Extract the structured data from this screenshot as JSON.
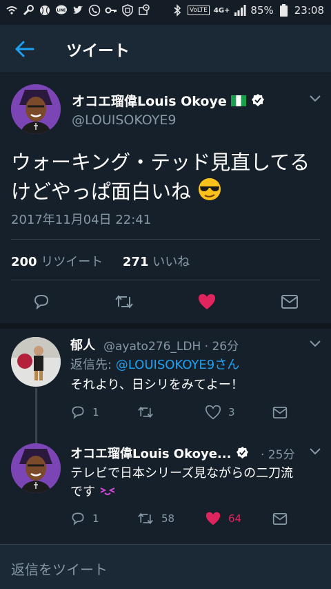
{
  "status_bar": {
    "battery": "85%",
    "time": "23:08",
    "volte": "VoLTE",
    "network": "4G+",
    "icons_left": [
      "wifi-on-icon",
      "wrench-icon",
      "baseball-icon",
      "line-icon",
      "twitter-icon",
      "phone-icon",
      "key-icon",
      "shield-icon",
      "screenshot-icon"
    ],
    "icons_right": [
      "bluetooth-icon",
      "volte-icon",
      "signal-icon",
      "battery-icon"
    ]
  },
  "header": {
    "title": "ツイート"
  },
  "tweet": {
    "author_name": "オコエ瑠偉Louis Okoye",
    "author_handle": "@LOUISOKOYE9",
    "text": "ウォーキング・テッド見直してるけどやっぱ面白いね",
    "timestamp": "2017年11月04日 22:41",
    "retweet_count": "200",
    "retweet_label": "リツイート",
    "like_count": "271",
    "like_label": "いいね"
  },
  "replies": [
    {
      "name": "郁人",
      "handle_time": "@ayato276_LDH · 26分",
      "reply_to_prefix": "返信先: ",
      "reply_to_link": "@LOUISOKOYE9さん",
      "text": "それより、日シリをみてよー！",
      "reply_count": "1",
      "retweet_count": "",
      "like_count": "3"
    },
    {
      "name": "オコエ瑠偉Louis Okoye...",
      "time": "· 25分",
      "text": "テレビで日本シリーズ見ながらの二刀流です",
      "reply_count": "1",
      "retweet_count": "58",
      "like_count": "64"
    }
  ],
  "reply_bar": {
    "placeholder": "返信をツイート"
  },
  "colors": {
    "background": "#15202b",
    "accent": "#1da1f2",
    "like": "#e0245e",
    "secondary_text": "#8899a6"
  }
}
